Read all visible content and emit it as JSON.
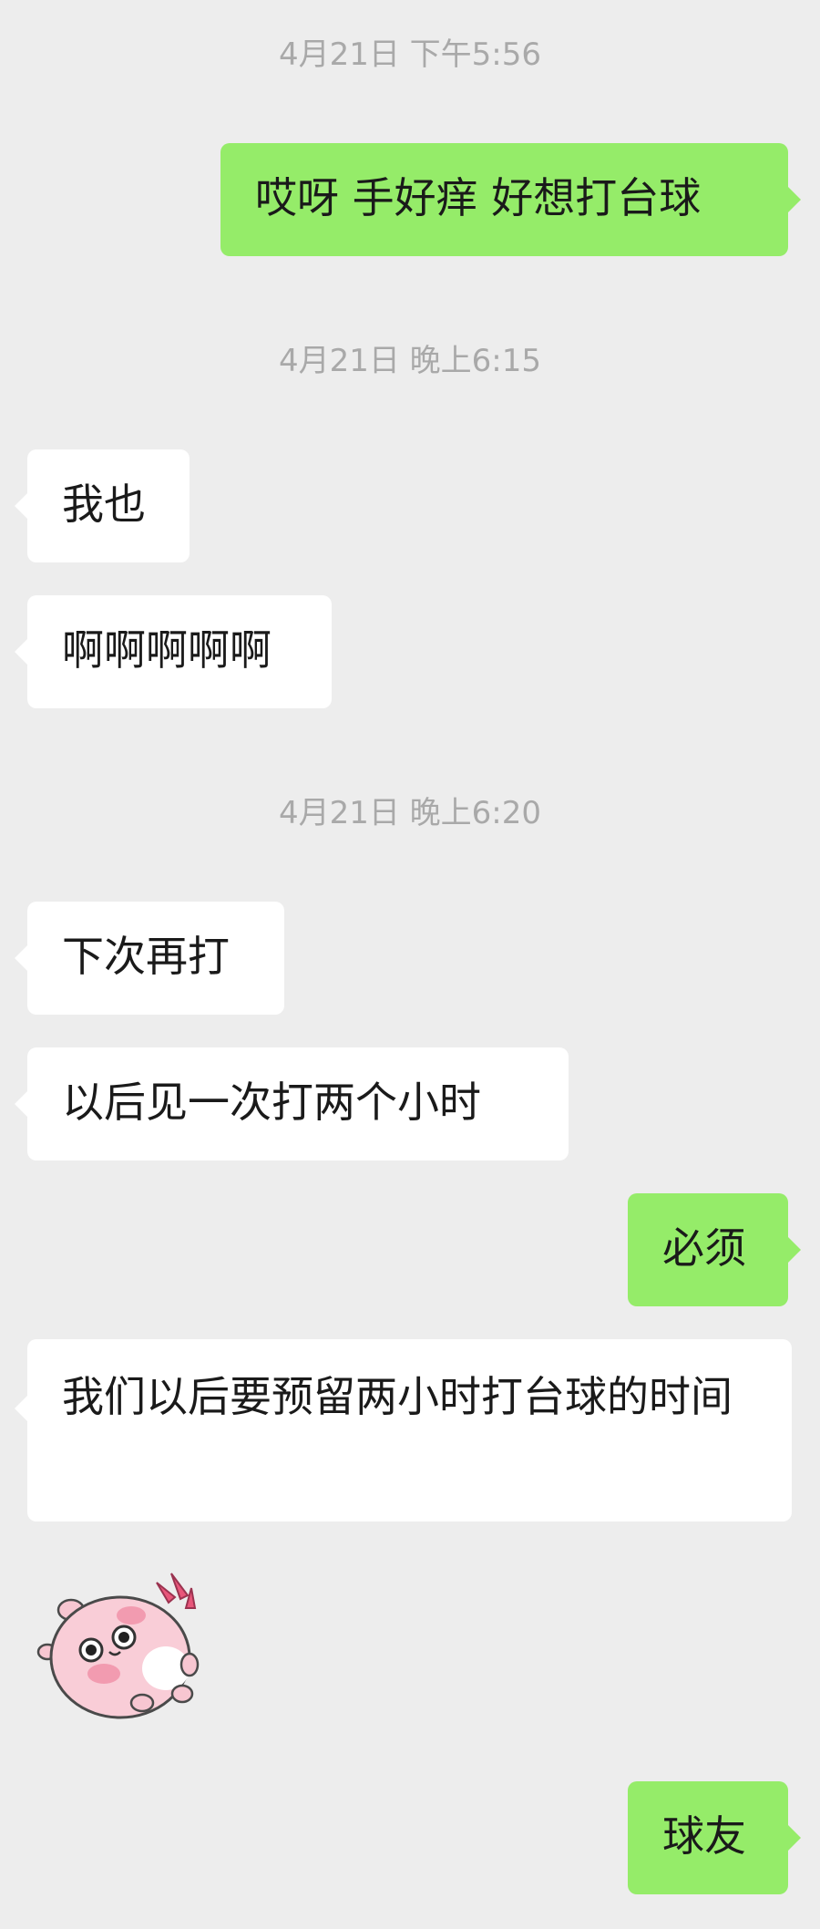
{
  "chat": {
    "timestamps": [
      "4月21日 下午5:56",
      "4月21日 晚上6:15",
      "4月21日 晚上6:20"
    ],
    "messages": [
      {
        "side": "right",
        "text": "哎呀 手好痒 好想打台球"
      },
      {
        "side": "left",
        "text": "我也"
      },
      {
        "side": "left",
        "text": "啊啊啊啊啊"
      },
      {
        "side": "left",
        "text": "下次再打"
      },
      {
        "side": "left",
        "text": "以后见一次打两个小时"
      },
      {
        "side": "right",
        "text": "必须"
      },
      {
        "side": "left",
        "text": "我们以后要预留两小时打台球的时间"
      },
      {
        "side": "left",
        "type": "sticker",
        "icon": "pink-hamster-sticker"
      },
      {
        "side": "right",
        "text": "球友"
      }
    ]
  },
  "colors": {
    "background": "#ededed",
    "outgoing_bubble": "#95ec69",
    "incoming_bubble": "#ffffff",
    "timestamp_text": "#a9a9a9",
    "message_text": "#1a1a1a"
  }
}
